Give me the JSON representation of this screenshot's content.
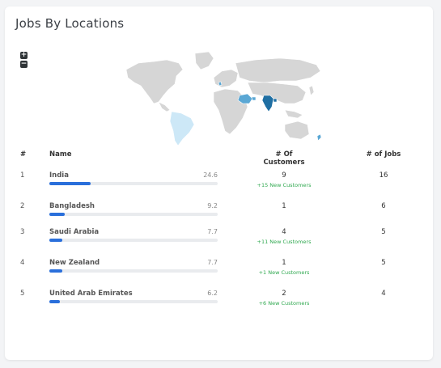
{
  "title": "Jobs By Locations",
  "zoom": {
    "in": "+",
    "out": "−"
  },
  "colors": {
    "accent": "#2a6fdb",
    "highlight_dark": "#1f6fa3",
    "highlight_mid": "#5aa7d4",
    "highlight_light": "#cde8f7",
    "land": "#d6d6d6",
    "green": "#2fa84f"
  },
  "headers": {
    "rank": "#",
    "name": "Name",
    "customers": "# Of Customers",
    "jobs": "# of Jobs"
  },
  "rows": [
    {
      "rank": "1",
      "name": "India",
      "percent": "24.6",
      "customers": "9",
      "new": "+15 New Customers",
      "jobs": "16"
    },
    {
      "rank": "2",
      "name": "Bangladesh",
      "percent": "9.2",
      "customers": "1",
      "new": "",
      "jobs": "6"
    },
    {
      "rank": "3",
      "name": "Saudi Arabia",
      "percent": "7.7",
      "customers": "4",
      "new": "+11 New Customers",
      "jobs": "5"
    },
    {
      "rank": "4",
      "name": "New Zealand",
      "percent": "7.7",
      "customers": "1",
      "new": "+1 New Customers",
      "jobs": "5"
    },
    {
      "rank": "5",
      "name": "United Arab Emirates",
      "percent": "6.2",
      "customers": "2",
      "new": "+6 New Customers",
      "jobs": "4"
    }
  ]
}
